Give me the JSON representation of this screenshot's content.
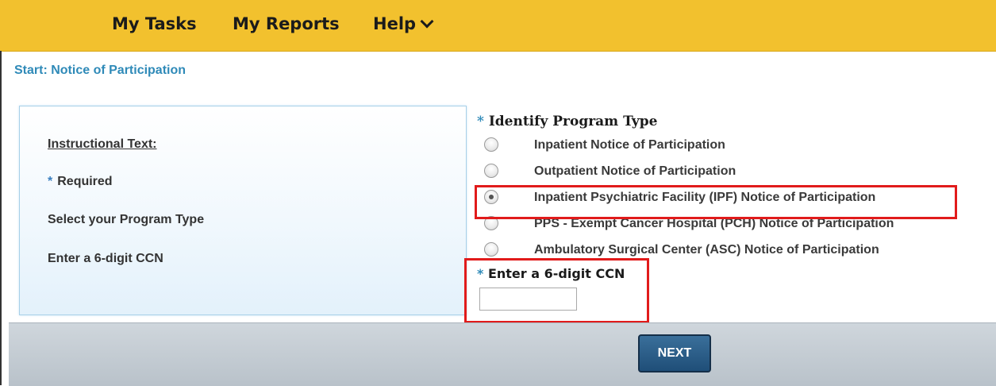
{
  "nav": {
    "items": [
      "My Tasks",
      "My Reports",
      "Help"
    ]
  },
  "breadcrumb": "Start: Notice of Participation",
  "instructions": {
    "heading": "Instructional Text:",
    "required_star": "*",
    "required_label": "Required",
    "line_program": "Select your Program Type",
    "line_ccn": "Enter a 6-digit CCN"
  },
  "program": {
    "star": "*",
    "title": "Identify Program Type",
    "options": [
      {
        "label": "Inpatient Notice of Participation",
        "checked": false
      },
      {
        "label": "Outpatient Notice of Participation",
        "checked": false
      },
      {
        "label": "Inpatient Psychiatric Facility (IPF) Notice of Participation",
        "checked": true
      },
      {
        "label": "PPS - Exempt Cancer Hospital (PCH) Notice of Participation",
        "checked": false
      },
      {
        "label": "Ambulatory Surgical Center (ASC) Notice of Participation",
        "checked": false
      }
    ]
  },
  "ccn": {
    "star": "*",
    "label": "Enter a 6-digit CCN",
    "value": ""
  },
  "footer": {
    "next_label": "NEXT"
  },
  "colors": {
    "nav_bg": "#f2c12e",
    "accent": "#2f8ab8",
    "highlight": "#e11b1b",
    "button": "#1f4e78"
  }
}
